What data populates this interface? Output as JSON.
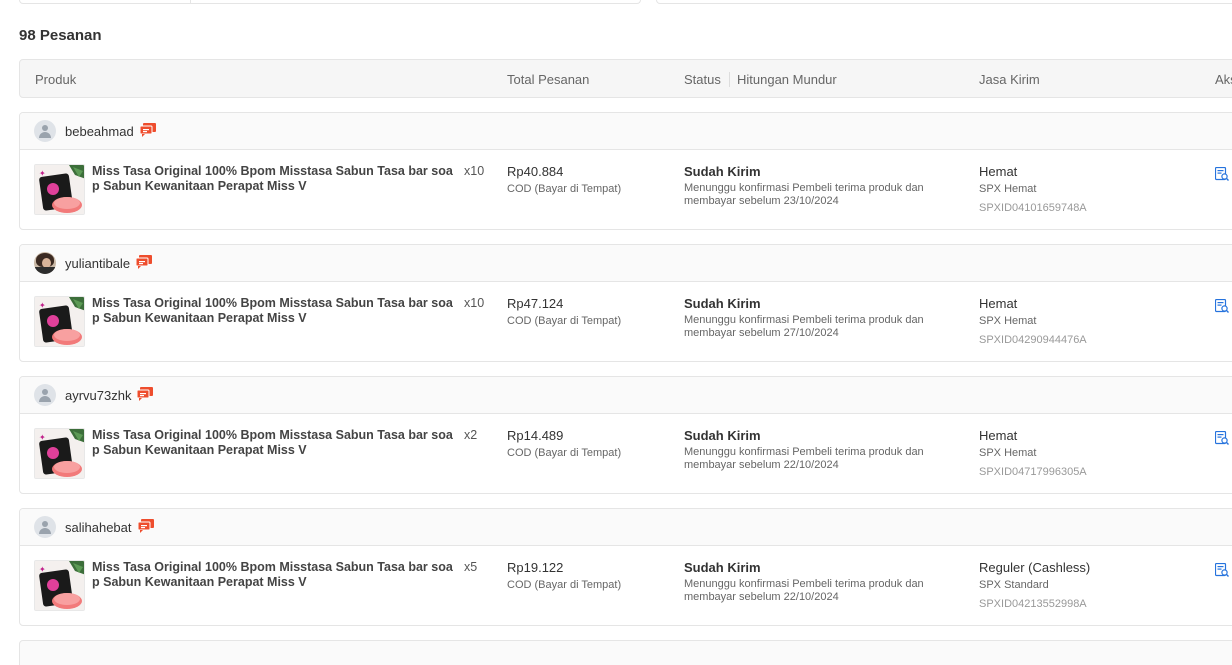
{
  "orders_count": "98 Pesanan",
  "table_header": {
    "produk": "Produk",
    "total": "Total Pesanan",
    "status": "Status",
    "countdown": "Hitungan Mundur",
    "jasa": "Jasa Kirim",
    "aksi": "Aksi"
  },
  "colors": {
    "chat_icon": "#ee4d2d",
    "detail_icon": "#2673dd",
    "header_bg": "#f6f6f6",
    "border": "#e5e5e5"
  },
  "icons": {
    "chat": "chat-bubble-icon",
    "detail": "order-detail-icon",
    "avatar": "user-avatar-icon"
  },
  "orders": [
    {
      "username": "bebeahmad",
      "product_name": "Miss Tasa Original 100% Bpom Misstasa Sabun Tasa bar soap Sabun Kewanitaan Perapat Miss V",
      "qty": "x10",
      "price": "Rp40.884",
      "payment": "COD (Bayar di Tempat)",
      "status": "Sudah Kirim",
      "status_desc": "Menunggu konfirmasi Pembeli terima produk dan membayar sebelum 23/10/2024",
      "ship_title": "Hemat",
      "ship_service": "SPX Hemat",
      "tracking": "SPXID04101659748A"
    },
    {
      "username": "yuliantibale",
      "product_name": "Miss Tasa Original 100% Bpom Misstasa Sabun Tasa bar soap Sabun Kewanitaan Perapat Miss V",
      "qty": "x10",
      "price": "Rp47.124",
      "payment": "COD (Bayar di Tempat)",
      "status": "Sudah Kirim",
      "status_desc": "Menunggu konfirmasi Pembeli terima produk dan membayar sebelum 27/10/2024",
      "ship_title": "Hemat",
      "ship_service": "SPX Hemat",
      "tracking": "SPXID04290944476A"
    },
    {
      "username": "ayrvu73zhk",
      "product_name": "Miss Tasa Original 100% Bpom Misstasa Sabun Tasa bar soap Sabun Kewanitaan Perapat Miss V",
      "qty": "x2",
      "price": "Rp14.489",
      "payment": "COD (Bayar di Tempat)",
      "status": "Sudah Kirim",
      "status_desc": "Menunggu konfirmasi Pembeli terima produk dan membayar sebelum 22/10/2024",
      "ship_title": "Hemat",
      "ship_service": "SPX Hemat",
      "tracking": "SPXID04717996305A"
    },
    {
      "username": "salihahebat",
      "product_name": "Miss Tasa Original 100% Bpom Misstasa Sabun Tasa bar soap Sabun Kewanitaan Perapat Miss V",
      "qty": "x5",
      "price": "Rp19.122",
      "payment": "COD (Bayar di Tempat)",
      "status": "Sudah Kirim",
      "status_desc": "Menunggu konfirmasi Pembeli terima produk dan membayar sebelum 22/10/2024",
      "ship_title": "Reguler (Cashless)",
      "ship_service": "SPX Standard",
      "tracking": "SPXID04213552998A"
    }
  ]
}
